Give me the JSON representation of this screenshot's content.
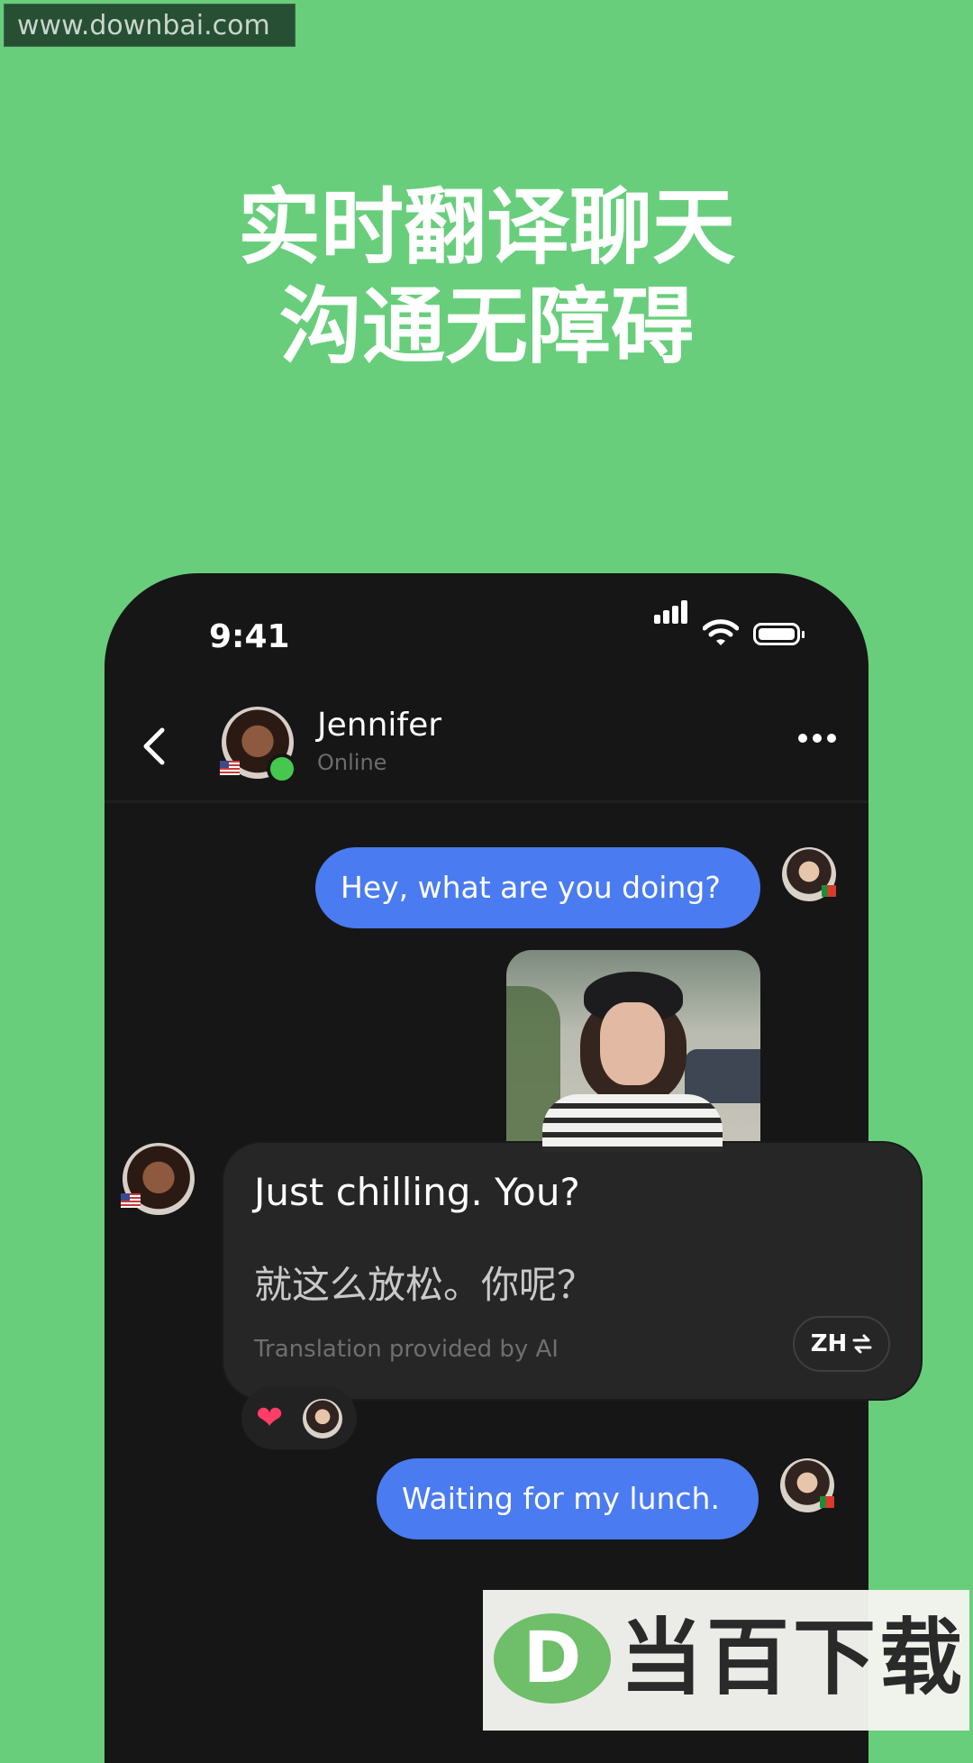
{
  "watermark_top": "www.downbai.com",
  "headline": {
    "line1": "实时翻译聊天",
    "line2": "沟通无障碍"
  },
  "status_bar": {
    "time": "9:41"
  },
  "chat_header": {
    "name": "Jennifer",
    "status": "Online"
  },
  "messages": {
    "m1": "Hey, what are you doing?",
    "incoming_original": "Just chilling. You?",
    "incoming_translation": "就这么放松。你呢？",
    "translation_note": "Translation provided by AI",
    "lang_button": "ZH",
    "m3": "Waiting for my lunch."
  },
  "icons": [
    "back-chevron-icon",
    "signal-icon",
    "wifi-icon",
    "battery-icon",
    "more-icon",
    "swap-icon",
    "heart-icon"
  ],
  "colors": {
    "background": "#68ce7c",
    "phone": "#161616",
    "bubble_outgoing": "#4a7bf0",
    "bubble_incoming": "#262626",
    "online": "#45c84d"
  },
  "watermark_bottom": {
    "logo_letter": "D",
    "text": "当百下载"
  }
}
